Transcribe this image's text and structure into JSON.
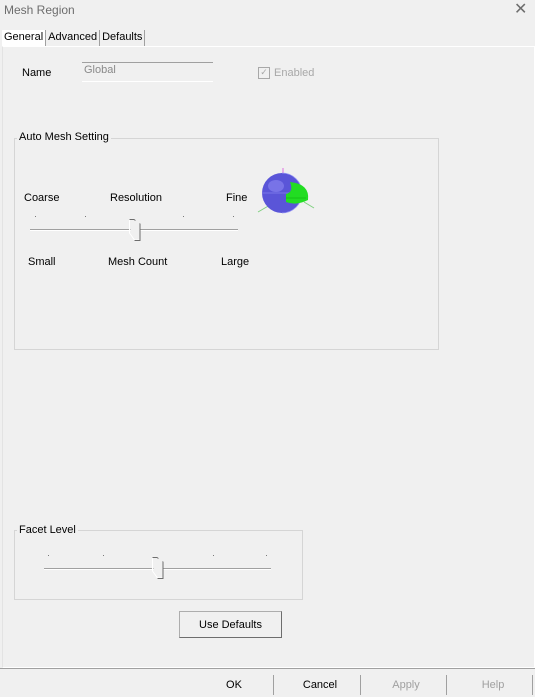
{
  "window": {
    "title": "Mesh Region",
    "close_glyph": "✕"
  },
  "tabs": [
    {
      "label": "General"
    },
    {
      "label": "Advanced"
    },
    {
      "label": "Defaults"
    }
  ],
  "general": {
    "name_label": "Name",
    "name_value": "Global",
    "enabled_label": "Enabled",
    "enabled_checked": true,
    "enabled_disabled": true
  },
  "auto_mesh": {
    "title": "Auto Mesh Setting",
    "resolution_labels": {
      "left": "Coarse",
      "center": "Resolution",
      "right": "Fine"
    },
    "count_labels": {
      "left": "Small",
      "center": "Mesh Count",
      "right": "Large"
    },
    "slider_value": 3,
    "slider_max": 6
  },
  "facet": {
    "title": "Facet Level",
    "slider_value": 3,
    "slider_max": 6
  },
  "use_defaults_label": "Use Defaults",
  "footer": {
    "ok": "OK",
    "cancel": "Cancel",
    "apply": "Apply",
    "help": "Help"
  },
  "colors": {
    "sphere": "#5a55d8",
    "mesh_green": "#22dd22",
    "disabled_text": "#a0a0a0"
  },
  "icons": {
    "preview": "mesh-preview-sphere-icon"
  }
}
